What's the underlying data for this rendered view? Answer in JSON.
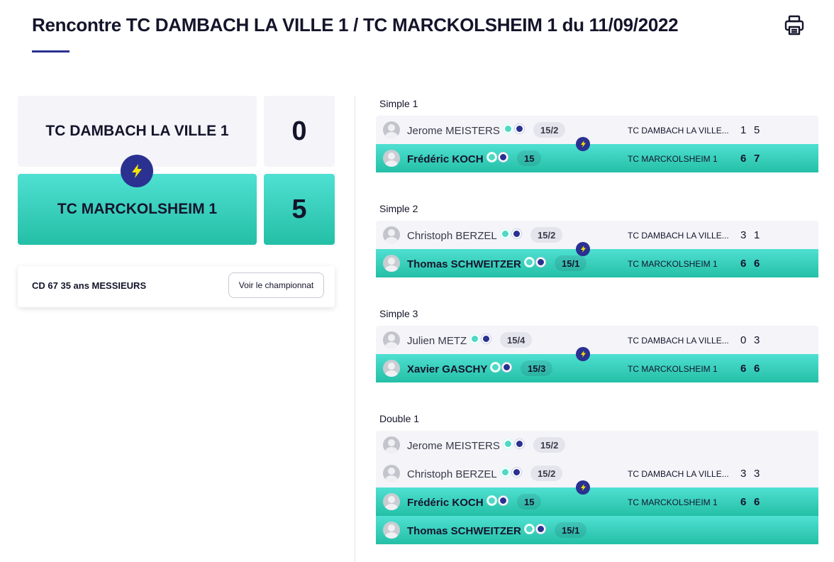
{
  "page": {
    "title": "Rencontre TC DAMBACH LA VILLE 1 / TC MARCKOLSHEIM 1 du 11/09/2022",
    "print_icon": "print-icon"
  },
  "summary": {
    "home_team": "TC DAMBACH LA VILLE 1",
    "home_score": "0",
    "away_team": "TC MARCKOLSHEIM 1",
    "away_score": "5",
    "winner_icon": "lightning-bolt-icon"
  },
  "championship": {
    "label": "CD 67 35 ans MESSIEURS",
    "button_label": "Voir le championnat"
  },
  "colors": {
    "accent": "#2a3190",
    "winner_gradient_top": "#4fe0d2",
    "winner_gradient_bottom": "#24bfa6",
    "bolt": "#f5e400",
    "home_background": "#f4f4f9"
  },
  "matches": [
    {
      "title": "Simple 1",
      "home": {
        "players": [
          {
            "name": "Jerome MEISTERS",
            "rank": "15/2"
          }
        ],
        "club": "TC DAMBACH LA VILLE...",
        "sets": [
          "1",
          "5"
        ]
      },
      "away": {
        "players": [
          {
            "name": "Frédéric KOCH",
            "rank": "15"
          }
        ],
        "club": "TC MARCKOLSHEIM 1",
        "sets": [
          "6",
          "7"
        ]
      }
    },
    {
      "title": "Simple 2",
      "home": {
        "players": [
          {
            "name": "Christoph BERZEL",
            "rank": "15/2"
          }
        ],
        "club": "TC DAMBACH LA VILLE...",
        "sets": [
          "3",
          "1"
        ]
      },
      "away": {
        "players": [
          {
            "name": "Thomas SCHWEITZER",
            "rank": "15/1"
          }
        ],
        "club": "TC MARCKOLSHEIM 1",
        "sets": [
          "6",
          "6"
        ]
      }
    },
    {
      "title": "Simple 3",
      "home": {
        "players": [
          {
            "name": "Julien METZ",
            "rank": "15/4"
          }
        ],
        "club": "TC DAMBACH LA VILLE...",
        "sets": [
          "0",
          "3"
        ]
      },
      "away": {
        "players": [
          {
            "name": "Xavier GASCHY",
            "rank": "15/3"
          }
        ],
        "club": "TC MARCKOLSHEIM 1",
        "sets": [
          "6",
          "6"
        ]
      }
    },
    {
      "title": "Double 1",
      "home": {
        "players": [
          {
            "name": "Jerome MEISTERS",
            "rank": "15/2"
          },
          {
            "name": "Christoph BERZEL",
            "rank": "15/2"
          }
        ],
        "club": "TC DAMBACH LA VILLE...",
        "sets": [
          "3",
          "3"
        ]
      },
      "away": {
        "players": [
          {
            "name": "Frédéric KOCH",
            "rank": "15"
          },
          {
            "name": "Thomas SCHWEITZER",
            "rank": "15/1"
          }
        ],
        "club": "TC MARCKOLSHEIM 1",
        "sets": [
          "6",
          "6"
        ]
      }
    }
  ]
}
